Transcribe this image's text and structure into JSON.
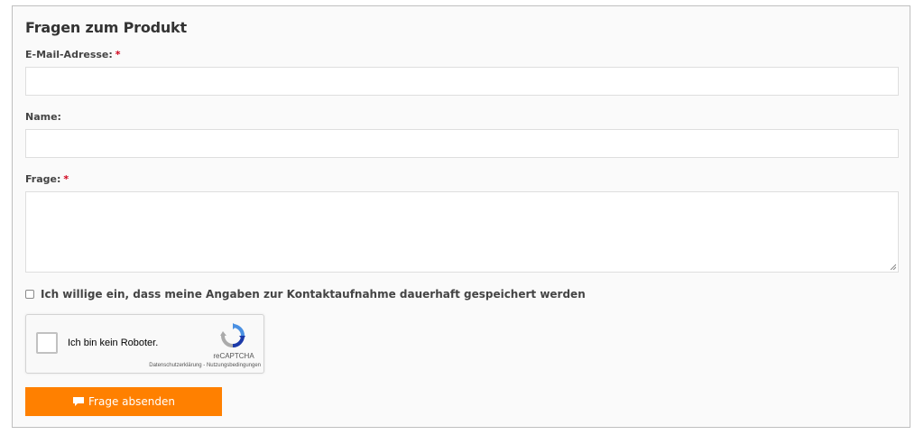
{
  "form": {
    "title": "Fragen zum Produkt",
    "required_marker": "*",
    "email": {
      "label": "E-Mail-Adresse:",
      "value": "",
      "placeholder": ""
    },
    "name": {
      "label": "Name:",
      "value": "",
      "placeholder": ""
    },
    "question": {
      "label": "Frage:",
      "value": "",
      "placeholder": ""
    },
    "consent": {
      "checked": false,
      "label": "Ich willige ein, dass meine Angaben zur Kontaktaufnahme dauerhaft gespeichert werden"
    },
    "captcha": {
      "checked": false,
      "label": "Ich bin kein Roboter.",
      "brand": "reCAPTCHA",
      "links": "Datenschutzerklärung - Nutzungsbedingungen",
      "icon": "recaptcha-logo-icon"
    },
    "submit": {
      "label": "Frage absenden",
      "icon": "speech-bubble-icon",
      "color": "#ff8000"
    }
  },
  "colors": {
    "required": "#d0021b",
    "panel_border": "#bfbfbf"
  }
}
